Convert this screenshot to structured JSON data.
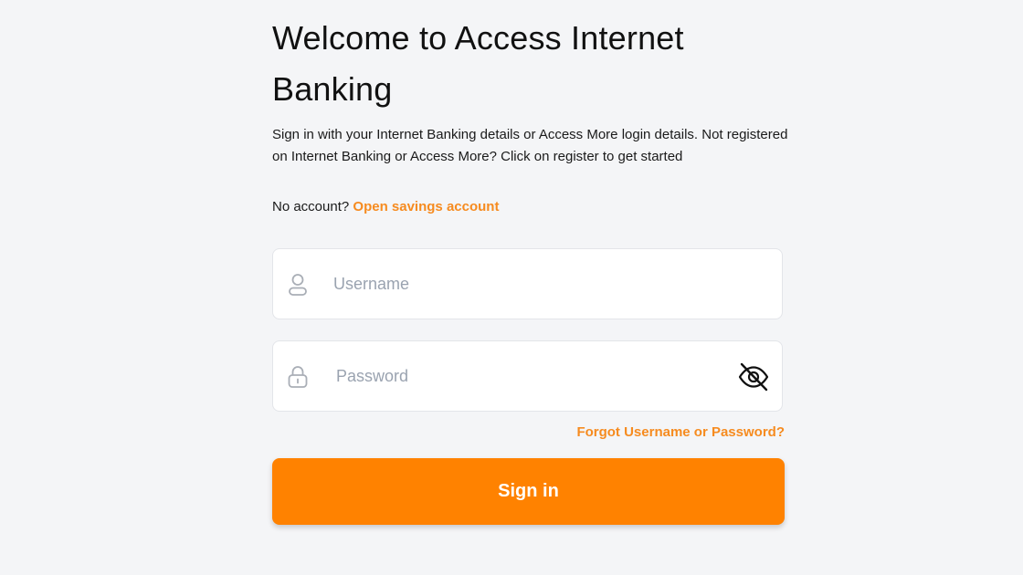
{
  "header": {
    "title": "Welcome to Access Internet Banking",
    "subtitle": "Sign in with your Internet Banking details or Access More login details. Not registered on Internet Banking or Access More? Click on register to get started"
  },
  "account_prompt": {
    "text": "No account?",
    "link_label": "Open savings account"
  },
  "form": {
    "username": {
      "placeholder": "Username",
      "value": "",
      "icon": "user-icon"
    },
    "password": {
      "placeholder": "Password",
      "value": "",
      "icon": "lock-icon",
      "toggle_icon": "eye-off-icon"
    },
    "forgot_label": "Forgot Username or Password?",
    "submit_label": "Sign in"
  },
  "colors": {
    "accent": "#ff8200",
    "link": "#f68b1f",
    "background": "#f4f5f7",
    "placeholder": "#9aa3b0"
  }
}
